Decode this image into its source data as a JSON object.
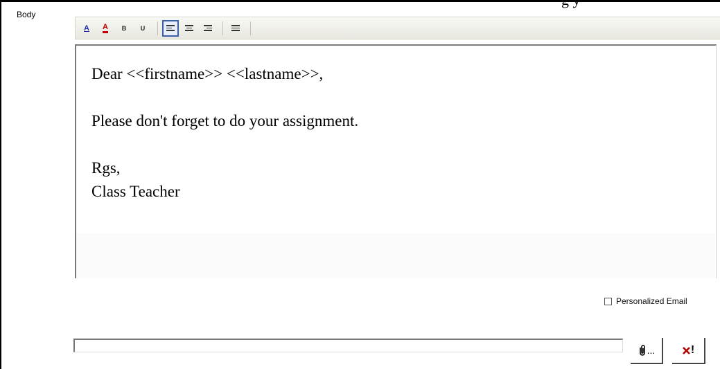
{
  "cut_text": "g                          y",
  "body_label": "Body",
  "toolbar": {
    "buttons": [
      {
        "name": "highlight-color",
        "glyph": "A"
      },
      {
        "name": "font-color",
        "glyph": "A"
      },
      {
        "name": "bold",
        "glyph": "B"
      },
      {
        "name": "underline",
        "glyph": "U"
      },
      {
        "name": "align-left",
        "active": true
      },
      {
        "name": "align-center"
      },
      {
        "name": "align-right"
      },
      {
        "name": "bullet-list"
      }
    ]
  },
  "editor": {
    "lines": [
      "Dear <<firstname>> <<lastname>>,",
      "",
      "Please don't forget to do your assignment.",
      "",
      "Rgs,",
      "Class Teacher"
    ]
  },
  "personalized_label": "Personalized Email",
  "attach_button_label": "...",
  "remove_button_label": "!",
  "colors": {
    "active_border": "#3a5fa6",
    "remove_icon": "#b00000",
    "highlight_icon": "#1c2fa8",
    "font_color_icon": "#c00000"
  }
}
